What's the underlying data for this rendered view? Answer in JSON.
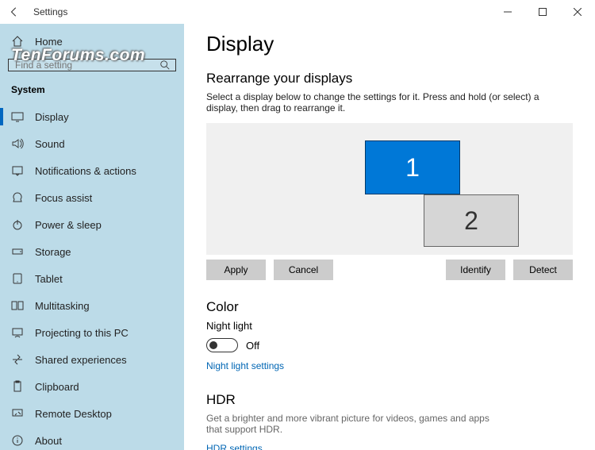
{
  "titlebar": {
    "title": "Settings"
  },
  "sidebar": {
    "home": "Home",
    "searchPlaceholder": "Find a setting",
    "section": "System",
    "items": [
      {
        "label": "Display"
      },
      {
        "label": "Sound"
      },
      {
        "label": "Notifications & actions"
      },
      {
        "label": "Focus assist"
      },
      {
        "label": "Power & sleep"
      },
      {
        "label": "Storage"
      },
      {
        "label": "Tablet"
      },
      {
        "label": "Multitasking"
      },
      {
        "label": "Projecting to this PC"
      },
      {
        "label": "Shared experiences"
      },
      {
        "label": "Clipboard"
      },
      {
        "label": "Remote Desktop"
      },
      {
        "label": "About"
      }
    ]
  },
  "main": {
    "title": "Display",
    "rearrange": {
      "heading": "Rearrange your displays",
      "desc": "Select a display below to change the settings for it. Press and hold (or select) a display, then drag to rearrange it.",
      "mon1": "1",
      "mon2": "2",
      "apply": "Apply",
      "cancel": "Cancel",
      "identify": "Identify",
      "detect": "Detect"
    },
    "color": {
      "heading": "Color",
      "nightLight": "Night light",
      "toggleState": "Off",
      "link": "Night light settings"
    },
    "hdr": {
      "heading": "HDR",
      "desc": "Get a brighter and more vibrant picture for videos, games and apps that support HDR.",
      "link": "HDR settings"
    }
  },
  "watermark": "TenForums.com"
}
